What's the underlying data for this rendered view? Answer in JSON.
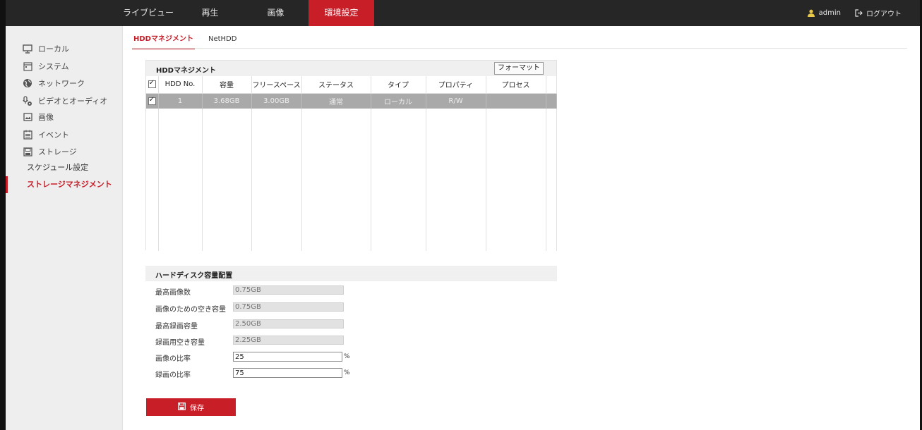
{
  "topnav": {
    "items": [
      "ライブビュー",
      "再生",
      "画像",
      "環境設定"
    ],
    "active_index": 3
  },
  "user": {
    "name": "admin",
    "logout_label": "ログアウト"
  },
  "sidebar": {
    "items": [
      {
        "label": "ローカル",
        "icon": "monitor-icon"
      },
      {
        "label": "システム",
        "icon": "system-icon"
      },
      {
        "label": "ネットワーク",
        "icon": "globe-icon"
      },
      {
        "label": "ビデオとオーディオ",
        "icon": "video-audio-icon"
      },
      {
        "label": "画像",
        "icon": "image-icon"
      },
      {
        "label": "イベント",
        "icon": "calendar-icon"
      },
      {
        "label": "ストレージ",
        "icon": "disk-icon"
      }
    ],
    "subitems": [
      {
        "label": "スケジュール設定",
        "active": false
      },
      {
        "label": "ストレージマネジメント",
        "active": true
      }
    ]
  },
  "tabs": [
    "HDDマネジメント",
    "NetHDD"
  ],
  "hdd": {
    "title": "HDDマネジメント",
    "format_button": "フォーマット",
    "columns": [
      "HDD No.",
      "容量",
      "フリースペース",
      "ステータス",
      "タイプ",
      "プロパティ",
      "プロセス"
    ],
    "rows": [
      {
        "no": "1",
        "capacity": "3.68GB",
        "free": "3.00GB",
        "status": "通常",
        "type": "ローカル",
        "property": "R/W",
        "process": ""
      }
    ]
  },
  "capacity": {
    "title": "ハードディスク容量配置",
    "fields": [
      {
        "label": "最高画像数",
        "value": "0.75GB"
      },
      {
        "label": "画像のための空き容量",
        "value": "0.75GB"
      },
      {
        "label": "最高録画容量",
        "value": "2.50GB"
      },
      {
        "label": "録画用空き容量",
        "value": "2.25GB"
      }
    ],
    "picture_ratio_label": "画像の比率",
    "picture_ratio_value": "25",
    "record_ratio_label": "録画の比率",
    "record_ratio_value": "75",
    "percent_unit": "%"
  },
  "save_label": "保存",
  "colors": {
    "accent": "#c81e28",
    "topbar": "#262626",
    "sidebar": "#eeeeee",
    "selected_row": "#a9a9a9"
  }
}
